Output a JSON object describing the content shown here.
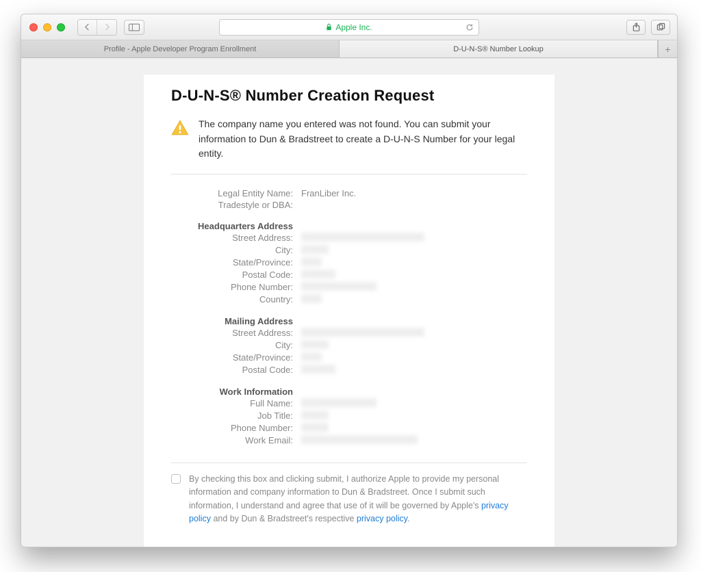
{
  "browser": {
    "url_label": "Apple Inc.",
    "tabs": [
      {
        "title": "Profile - Apple Developer Program Enrollment",
        "active": false
      },
      {
        "title": "D-U-N-S® Number Lookup",
        "active": true
      }
    ]
  },
  "page": {
    "title": "D-U-N-S® Number Creation Request",
    "alert": "The company name you entered was not found. You can submit your information to Dun & Bradstreet to create a D-U-N-S Number for your legal entity.",
    "entity": {
      "legal_name_label": "Legal Entity Name:",
      "legal_name_value": "FranLiber Inc.",
      "tradestyle_label": "Tradestyle or DBA:",
      "tradestyle_value": ""
    },
    "hq": {
      "heading": "Headquarters Address",
      "street_label": "Street Address:",
      "city_label": "City:",
      "state_label": "State/Province:",
      "postal_label": "Postal Code:",
      "phone_label": "Phone Number:",
      "country_label": "Country:"
    },
    "mailing": {
      "heading": "Mailing Address",
      "street_label": "Street Address:",
      "city_label": "City:",
      "state_label": "State/Province:",
      "postal_label": "Postal Code:"
    },
    "work": {
      "heading": "Work Information",
      "fullname_label": "Full Name:",
      "jobtitle_label": "Job Title:",
      "phone_label": "Phone Number:",
      "email_label": "Work Email:"
    },
    "consent": {
      "pre": "By checking this box and clicking submit, I authorize Apple to provide my personal information and company information to Dun & Bradstreet. Once I submit such information, I understand and agree that use of it will be governed by Apple's ",
      "link1": "privacy policy",
      "mid": " and by Dun & Bradstreet's respective ",
      "link2": "privacy policy",
      "post": "."
    }
  }
}
